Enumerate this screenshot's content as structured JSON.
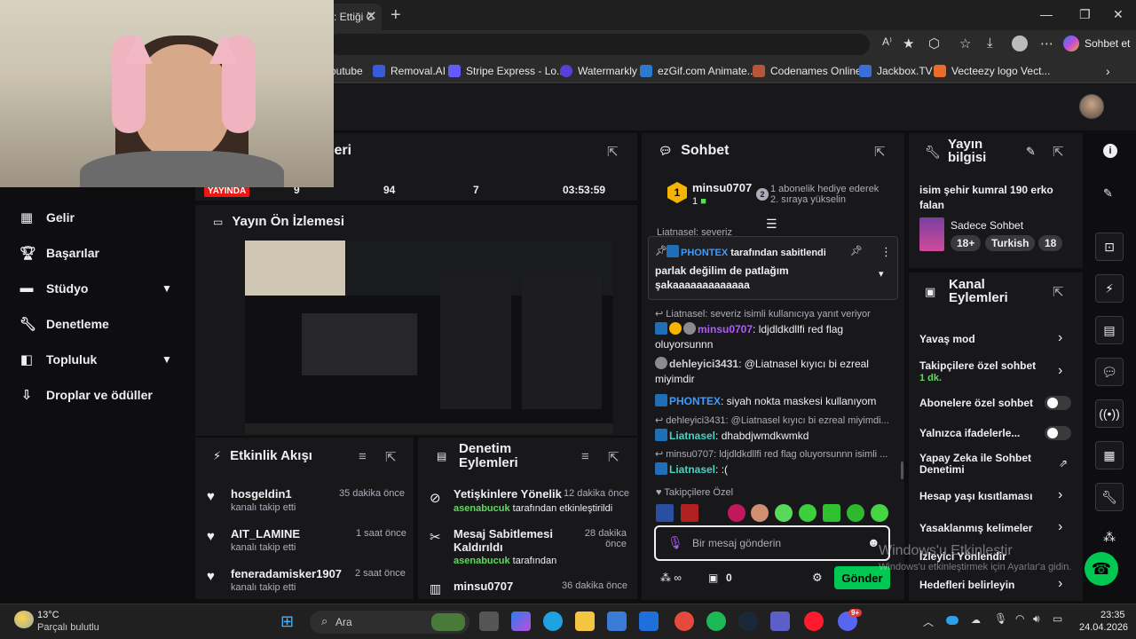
{
  "browser": {
    "active_tab_title": ": Ettiği C",
    "copilot_label": "Sohbet et",
    "bookmarks": [
      "outube",
      "Removal.AI",
      "Stripe Express - Lo...",
      "Watermarkly",
      "ezGif.com Animate...",
      "Codenames Online",
      "Jackbox.TV",
      "Vecteezy logo Vect..."
    ]
  },
  "sidebar": {
    "items": [
      {
        "label": "Gelir",
        "icon": "income-icon"
      },
      {
        "label": "Başarılar",
        "icon": "trophy-icon"
      },
      {
        "label": "Stüdyo",
        "icon": "studio-icon",
        "expandable": true
      },
      {
        "label": "Denetleme",
        "icon": "wrench-icon"
      },
      {
        "label": "Topluluk",
        "icon": "community-icon",
        "expandable": true
      },
      {
        "label": "Droplar ve ödüller",
        "icon": "drops-icon"
      }
    ]
  },
  "stats": {
    "header_fragment": "leri",
    "live_label": "YAYINDA",
    "values": [
      "9",
      "94",
      "7",
      "03:53:59"
    ]
  },
  "preview": {
    "title": "Yayın Ön İzlemesi"
  },
  "activity_feed": {
    "title": "Etkinlik Akışı",
    "items": [
      {
        "name": "hosgeldin1",
        "action": "kanalı takip etti",
        "time": "35 dakika önce"
      },
      {
        "name": "AIT_LAMINE",
        "action": "kanalı takip etti",
        "time": "1 saat önce"
      },
      {
        "name": "feneradamisker1907",
        "action": "kanalı takip etti",
        "time": "2 saat önce"
      }
    ]
  },
  "mod_actions": {
    "title": "Denetim Eylemleri",
    "items": [
      {
        "title": "Yetişkinlere Yönelik",
        "actor": "asenabucuk",
        "suffix": "tarafından etkinleştirildi",
        "time": "12 dakika önce"
      },
      {
        "title": "Mesaj Sabitlemesi Kaldırıldı",
        "actor": "asenabucuk",
        "suffix": "tarafından",
        "time": "28 dakika önce"
      },
      {
        "title": "minsu0707",
        "actor": "",
        "suffix": "",
        "time": "36 dakika önce"
      }
    ]
  },
  "chat": {
    "title": "Sohbet",
    "top_gifter": {
      "rank": "1",
      "name": "minsu0707",
      "count": "1",
      "goal_text": "1 abonelik hediye ederek 2. sıraya yükselin"
    },
    "clipped_text": "Liatnasel: severiz",
    "pinned": {
      "by": "PHONTEX",
      "by_suffix": "tarafından sabitlendi",
      "message": "parlak değilim de patlağım şakaaaaaaaaaaaaa"
    },
    "messages": [
      {
        "reply": "Liatnasel: severiz isimli kullanıcıya yanıt veriyor",
        "user": "minsu0707",
        "text": ": ldjdldkdllfi red flag oluyorsunnn",
        "color": "purple"
      },
      {
        "reply": "",
        "user": "dehleyici3431",
        "text": ": @Liatnasel kıyıcı bi ezreal miyimdir",
        "color": "gray"
      },
      {
        "reply": "",
        "user": "PHONTEX",
        "text": ": siyah nokta maskesi kullanıyom",
        "color": "blue"
      },
      {
        "reply": "dehleyici3431: @Liatnasel kıyıcı bi ezreal miyimdi...",
        "user": "Liatnasel",
        "text": ": dhabdjwmdkwmkd",
        "color": "teal"
      },
      {
        "reply": "minsu0707: ldjdldkdllfi red flag oluyorsunnn isimli ...",
        "user": "Liatnasel",
        "text": ": :(",
        "color": "teal"
      }
    ],
    "emote_section": "Takipçilere Özel",
    "input_placeholder": "Bir mesaj gönderin",
    "points": "0",
    "send_label": "Gönder"
  },
  "stream_info": {
    "title": "Yayın bilgisi",
    "stream_title": "isim şehir kumral 190 erko falan",
    "category": "Sadece Sohbet",
    "tags": [
      "18+",
      "Turkish",
      "18"
    ]
  },
  "channel_actions": {
    "title": "Kanal Eylemleri",
    "items": [
      {
        "label": "Yavaş mod",
        "control": "arrow"
      },
      {
        "label": "Takipçilere özel sohbet",
        "sub": "1 dk.",
        "control": "arrow"
      },
      {
        "label": "Abonelere özel sohbet",
        "control": "toggle"
      },
      {
        "label": "Yalnızca ifadelerle...",
        "control": "toggle"
      },
      {
        "label": "Yapay Zeka ile Sohbet Denetimi",
        "control": "external"
      },
      {
        "label": "Hesap yaşı kısıtlaması",
        "control": "arrow"
      },
      {
        "label": "Yasaklanmış kelimeler",
        "control": "arrow"
      },
      {
        "label": "İzleyici Yönlendir",
        "control": "arrow"
      },
      {
        "label": "Hedefleri belirleyin",
        "control": "arrow"
      }
    ]
  },
  "watermark": {
    "line1": "Windows'u Etkinleştir",
    "line2": "Windows'u etkinleştirmek için Ayarlar'a gidin."
  },
  "taskbar": {
    "weather_temp": "13°C",
    "weather_desc": "Parçalı bulutlu",
    "search_placeholder": "Ara",
    "time": "23:35",
    "date": "24.04.2026",
    "notification_badge": "9+"
  }
}
